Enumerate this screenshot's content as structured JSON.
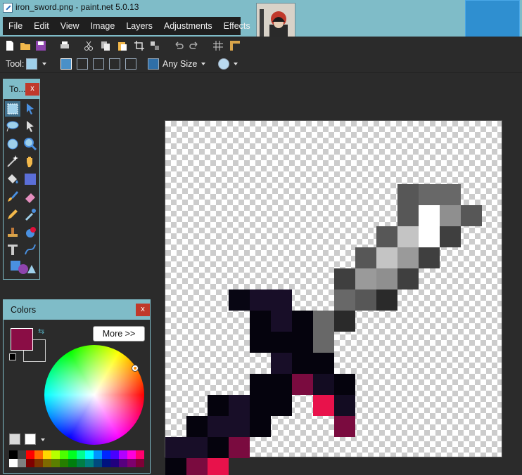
{
  "window": {
    "title": "iron_sword.png - paint.net 5.0.13"
  },
  "menu": [
    {
      "id": "file",
      "label": "File"
    },
    {
      "id": "edit",
      "label": "Edit"
    },
    {
      "id": "view",
      "label": "View"
    },
    {
      "id": "image",
      "label": "Image"
    },
    {
      "id": "layers",
      "label": "Layers"
    },
    {
      "id": "adjustments",
      "label": "Adjustments"
    },
    {
      "id": "effects",
      "label": "Effects"
    }
  ],
  "toolbar": {
    "icons": [
      "new-icon",
      "open-icon",
      "save-icon",
      "print-icon",
      "cut-icon",
      "copy-icon",
      "paste-icon",
      "crop-icon",
      "deselect-icon",
      "undo-icon",
      "redo-icon",
      "grid-icon",
      "ruler-icon"
    ]
  },
  "tool_options": {
    "tool_label": "Tool:",
    "sampling_size": "Any Size"
  },
  "tools_panel": {
    "title": "To...",
    "close_label": "x",
    "tools": [
      "rectangle-select",
      "move-selection",
      "lasso-select",
      "move-selected-pixels",
      "ellipse-select",
      "zoom",
      "magic-wand",
      "pan",
      "paint-bucket",
      "gradient",
      "paintbrush",
      "eraser",
      "pencil",
      "color-picker",
      "clone-stamp",
      "recolor",
      "text",
      "line-curve",
      "shapes"
    ]
  },
  "colors_panel": {
    "title": "Colors",
    "close_label": "x",
    "more_label": "More >>",
    "primary_color": "#8a0d45",
    "secondary_color": "#2b2b2b",
    "palette": [
      "#000000",
      "#404040",
      "#ff0000",
      "#ff6a00",
      "#ffd800",
      "#b6ff00",
      "#4cff00",
      "#00ff21",
      "#00ff90",
      "#00ffff",
      "#0094ff",
      "#0026ff",
      "#4800ff",
      "#b200ff",
      "#ff00dc",
      "#ff006e",
      "#ffffff",
      "#808080",
      "#7f0000",
      "#7f3300",
      "#7f6a00",
      "#5b7f00",
      "#267f00",
      "#007f0e",
      "#007f46",
      "#007f7f",
      "#004a7f",
      "#00137f",
      "#21007f",
      "#57007f",
      "#7f006e",
      "#7f0037"
    ]
  },
  "canvas_colors": {
    "c1": "#575757",
    "c2": "#686868",
    "c3": "#ffffff",
    "c4": "#8f8f8f",
    "c5": "#c4c4c4",
    "c6": "#3f3f3f",
    "c7": "#2a2a2a",
    "c8": "#9a9a9a",
    "c9": "#080613",
    "c10": "#180e28",
    "c11": "#05030d",
    "c12": "#7a0b3f",
    "c13": "#e8124b",
    "c14": "#130c22"
  }
}
